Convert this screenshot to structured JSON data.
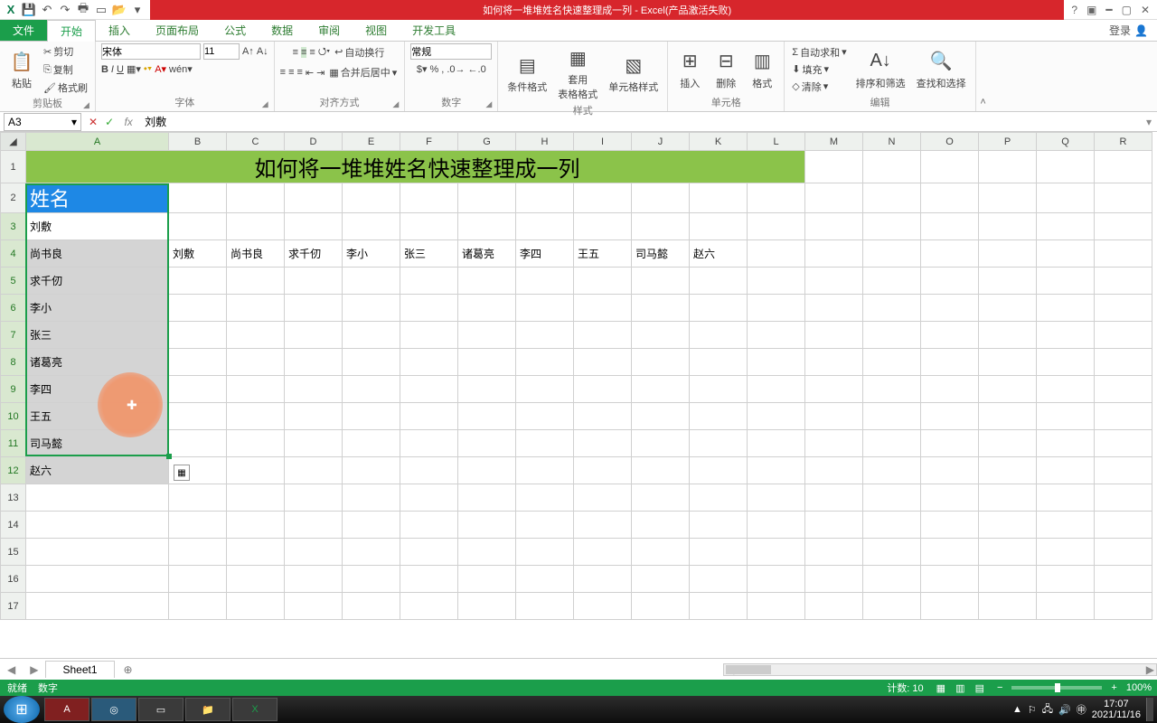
{
  "titlebar": {
    "doc_title": "如何将一堆堆姓名快速整理成一列 - Excel(产品激活失败)",
    "help": "?",
    "login": "登录"
  },
  "tabs": {
    "file": "文件",
    "items": [
      "开始",
      "插入",
      "页面布局",
      "公式",
      "数据",
      "审阅",
      "视图",
      "开发工具"
    ],
    "active_index": 0
  },
  "ribbon": {
    "clipboard": {
      "paste": "粘贴",
      "cut": "剪切",
      "copy": "复制",
      "format_painter": "格式刷",
      "label": "剪贴板"
    },
    "font": {
      "name": "宋体",
      "size": "11",
      "label": "字体"
    },
    "align": {
      "wrap": "自动换行",
      "merge": "合并后居中",
      "label": "对齐方式"
    },
    "number": {
      "format": "常规",
      "label": "数字"
    },
    "styles": {
      "cond": "条件格式",
      "table": "套用\n表格格式",
      "cell": "单元格样式",
      "label": "样式"
    },
    "cells": {
      "insert": "插入",
      "delete": "删除",
      "format": "格式",
      "label": "单元格"
    },
    "editing": {
      "autosum": "自动求和",
      "fill": "填充",
      "clear": "清除",
      "sort": "排序和筛选",
      "find": "查找和选择",
      "label": "编辑"
    }
  },
  "formula_bar": {
    "name_box": "A3",
    "formula": "刘敷"
  },
  "columns": [
    "A",
    "B",
    "C",
    "D",
    "E",
    "F",
    "G",
    "H",
    "I",
    "J",
    "K",
    "L",
    "M",
    "N",
    "O",
    "P",
    "Q",
    "R"
  ],
  "sheet": {
    "title_row": "如何将一堆堆姓名快速整理成一列",
    "header_name": "姓名",
    "colA": [
      "刘敷",
      "尚书良",
      "求千仞",
      "李小",
      "张三",
      "诸葛亮",
      "李四",
      "王五",
      "司马懿",
      "赵六"
    ],
    "row4": [
      "刘敷",
      "尚书良",
      "求千仞",
      "李小",
      "张三",
      "诸葛亮",
      "李四",
      "王五",
      "司马懿",
      "赵六"
    ]
  },
  "chart_data": {
    "type": "table",
    "title": "如何将一堆堆姓名快速整理成一列",
    "columns_header": "姓名",
    "column_values": [
      "刘敷",
      "尚书良",
      "求千仞",
      "李小",
      "张三",
      "诸葛亮",
      "李四",
      "王五",
      "司马懿",
      "赵六"
    ],
    "source_row": [
      "刘敷",
      "尚书良",
      "求千仞",
      "李小",
      "张三",
      "诸葛亮",
      "李四",
      "王五",
      "司马懿",
      "赵六"
    ]
  },
  "sheet_tabs": {
    "sheet1": "Sheet1"
  },
  "status": {
    "ready": "就绪",
    "scroll": "数字",
    "count_label": "计数: 10",
    "zoom": "100%"
  },
  "taskbar": {
    "time": "17:07",
    "date": "2021/11/16"
  }
}
